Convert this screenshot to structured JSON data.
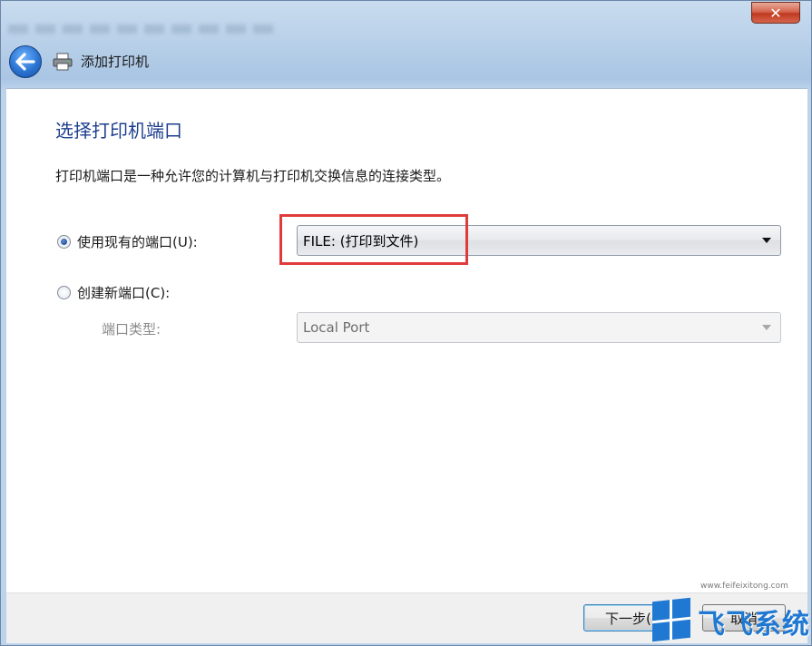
{
  "window": {
    "close_glyph": "✕"
  },
  "nav": {
    "title": "添加打印机",
    "back_icon": "back-arrow-icon",
    "printer_icon": "printer-icon"
  },
  "page": {
    "heading": "选择打印机端口",
    "description": "打印机端口是一种允许您的计算机与打印机交换信息的连接类型。"
  },
  "options": {
    "use_existing": {
      "label": "使用现有的端口(U):",
      "selected": true,
      "value": "FILE: (打印到文件)"
    },
    "create_new": {
      "label": "创建新端口(C):",
      "selected": false,
      "port_type_label": "端口类型:",
      "port_type_value": "Local Port"
    }
  },
  "footer": {
    "next_label": "下一步(N)",
    "cancel_label": "取消"
  },
  "watermark": {
    "brand": "飞飞系统",
    "url": "www.feifeixitong.com"
  },
  "colors": {
    "heading": "#1e3f8f",
    "highlight": "#e03b3b",
    "watermark": "#1f78d1"
  }
}
